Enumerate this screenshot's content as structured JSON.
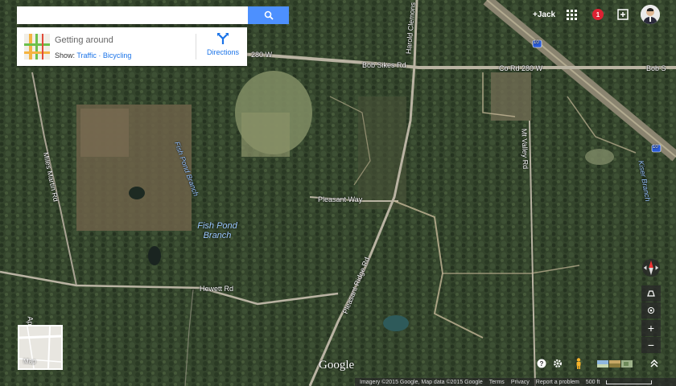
{
  "search": {
    "placeholder": "",
    "value": ""
  },
  "card": {
    "title": "Getting around",
    "show_label": "Show:",
    "traffic": "Traffic",
    "separator": "·",
    "bicycling": "Bicycling",
    "directions": "Directions"
  },
  "header": {
    "user": "+Jack",
    "notification_count": "1"
  },
  "map": {
    "roads": [
      "280 W",
      "Bob Sikes Rd",
      "Co Rd 280 W",
      "Bob S",
      "Harold Clemons",
      "Miles Martin Rd",
      "Fish Pond Branch",
      "Pleasant Way",
      "Mt Valley Rd",
      "Kiser Branch",
      "Hewett Rd",
      "Pleasant Ridge Rd",
      "Ap",
      "10",
      "10"
    ],
    "water_label": "Fish Pond Branch",
    "google": "Google",
    "minimap_label": "Map"
  },
  "footer": {
    "attribution": "Imagery ©2015 Google, Map data ©2015 Google",
    "terms": "Terms",
    "privacy": "Privacy",
    "report": "Report a problem",
    "scale": "500 ft"
  },
  "colors": {
    "accent": "#4d90fe",
    "link": "#1a73e8",
    "badge": "#dd2233"
  }
}
